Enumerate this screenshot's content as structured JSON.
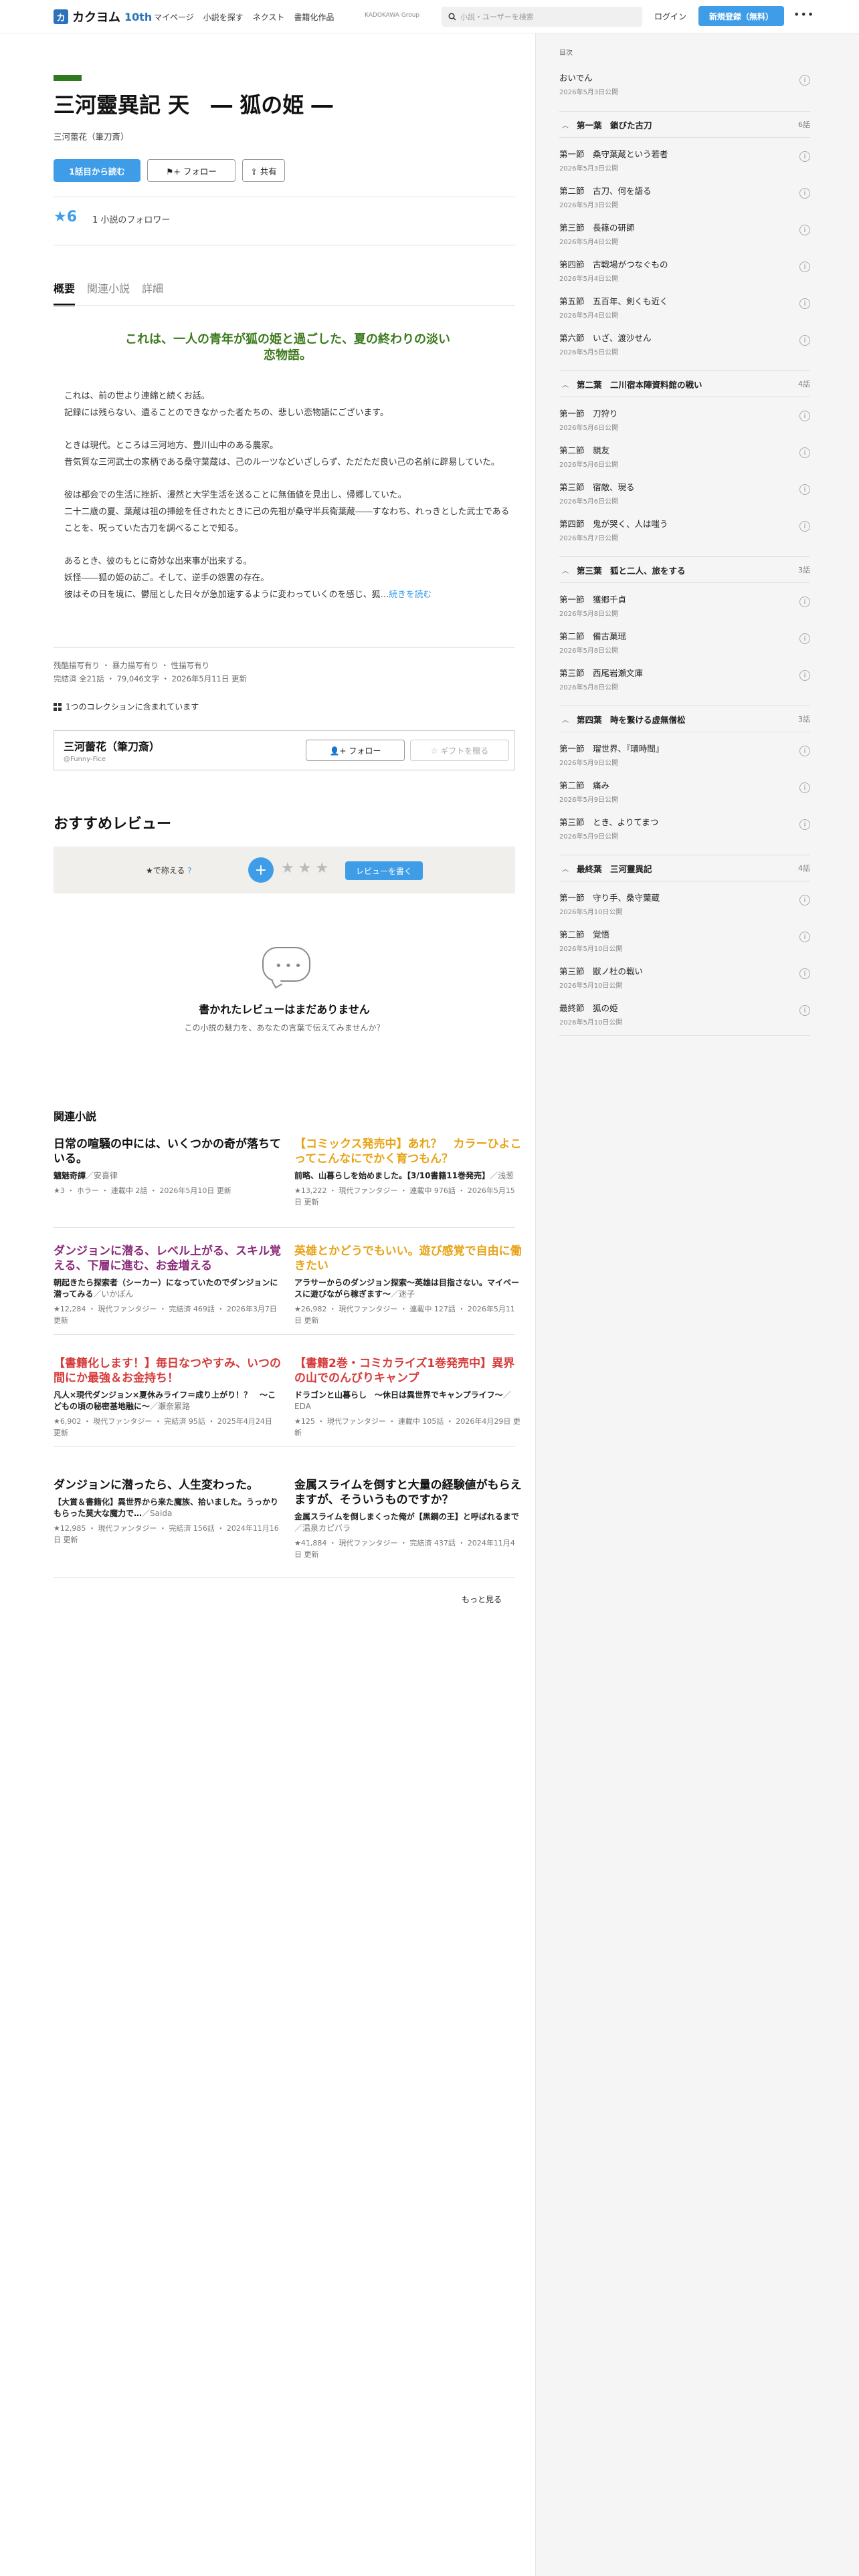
{
  "header": {
    "logo_mark": "カ",
    "logo_text": "カクヨム",
    "logo_10": "10th",
    "nav": [
      "マイページ",
      "小説を探す",
      "ネクスト",
      "書籍化作品"
    ],
    "group": "KADOKAWA Group",
    "search_placeholder": "小説・ユーザーを検索",
    "login": "ログイン",
    "signup": "新規登録（無料）",
    "more": "•••"
  },
  "work": {
    "title": "三河靈異記 天　― 狐の姫 ―",
    "author": "三河蕾花（筆刀斎）",
    "read_btn": "1話目から読む",
    "follow_btn": "フォロー",
    "share_btn": "共有",
    "stars": "★6",
    "followers": "1 小説のフォロワー",
    "tabs": [
      "概要",
      "関連小説",
      "詳細"
    ],
    "catchcopy": "これは、一人の青年が狐の姫と過ごした、夏の終わりの淡い恋物語。",
    "intro": [
      "これは、前の世より連綿と続くお話。\n記録には残らない、遺ることのできなかった者たちの、悲しい恋物語にございます。",
      "ときは現代。ところは三河地方、豊川山中のある農家。\n昔気質な三河武士の家柄である桑守葉蔵は、己のルーツなどいざしらず、ただただ良い己の名前に辟易していた。",
      "彼は都会での生活に挫折、漫然と大学生活を送ることに無価値を見出し、帰郷していた。\n二十二歳の夏、葉蔵は祖の挿絵を任されたときに己の先祖が桑守半兵衛葉蔵――すなわち、れっきとした武士であることを、呪っていた古刀を調べることで知る。",
      "あるとき、彼のもとに奇妙な出来事が出来する。\n妖怪――狐の姫の訪ご。そして、逆手の怨霊の存在。\n彼はその日を境に、鬱屈とした日々が急加速するように変わっていくのを感じ、狐…"
    ],
    "readmore": "続きを読む",
    "tags": "残酷描写有り ・ 暴力描写有り ・ 性描写有り",
    "status": "完結済 全21話 ・ 79,046文字 ・ 2026年5月11日 更新",
    "collection": "1つのコレクションに含まれています",
    "author_box": {
      "name": "三河蕾花（筆刀斎）",
      "id": "@Funny-Fice",
      "follow": "フォロー",
      "gift": "ギフトを贈る"
    }
  },
  "reviews": {
    "heading": "おすすめレビュー",
    "label": "★で称える",
    "help": "?",
    "plus": "+",
    "stars": "★★★",
    "write": "レビューを書く",
    "empty_title": "書かれたレビューはまだありません",
    "empty_sub": "この小説の魅力を、あなたの言葉で伝えてみませんか？",
    "bubble": "•••"
  },
  "related": {
    "heading": "関連小説",
    "more": "もっと見る",
    "items": [
      {
        "title": "日常の喧騒の中には、いくつかの奇が落ちている。",
        "color": "#111111",
        "sub": "魑魅奇譚",
        "sub_author": "／安喜律",
        "meta": "★3 ・ ホラー ・ 連載中 2話 ・ 2026年5月10日 更新"
      },
      {
        "title": "【コミックス発売中】あれ？　カラーひよこってこんなにでかく育つもん？",
        "color": "#e8a317",
        "sub": "前略、山暮らしを始めました。【3/10書籍11巻発売】",
        "sub_author": "／浅葱",
        "meta": "★13,222 ・ 現代ファンタジー ・ 連載中 976話 ・ 2026年5月15日 更新"
      },
      {
        "title": "ダンジョンに潜る、レベル上がる、スキル覚える、下層に進む、お金増える",
        "color": "#8a2a7a",
        "sub": "朝起きたら探索者（シーカー）になっていたのでダンジョンに潜ってみる",
        "sub_author": "／いかぽん",
        "meta": "★12,284 ・ 現代ファンタジー ・ 完結済 469話 ・ 2026年3月7日 更新"
      },
      {
        "title": "英雄とかどうでもいい。遊び感覚で自由に働きたい",
        "color": "#e8a317",
        "sub": "アラサーからのダンジョン探索〜英雄は目指さない。マイペースに遊びながら稼ぎます〜",
        "sub_author": "／迷子",
        "meta": "★26,982 ・ 現代ファンタジー ・ 連載中 127話 ・ 2026年5月11日 更新"
      },
      {
        "title": "【書籍化します！】毎日なつやすみ、いつの間にか最強＆お金持ち！",
        "color": "#d63a3a",
        "sub": "凡人×現代ダンジョン×夏休みライフ＝成り上がり！？　〜こどもの頃の秘密基地融に〜",
        "sub_author": "／瀬奈累路",
        "meta": "★6,902 ・ 現代ファンタジー ・ 完結済 95話 ・ 2025年4月24日 更新"
      },
      {
        "title": "【書籍2巻・コミカライズ1巻発売中】異界の山でのんびりキャンプ",
        "color": "#d63a3a",
        "sub": "ドラゴンと山暮らし　〜休日は異世界でキャンプライフ〜",
        "sub_author": "／EDA",
        "meta": "★125 ・ 現代ファンタジー ・ 連載中 105話 ・ 2026年4月29日 更新"
      },
      {
        "title": "ダンジョンに潜ったら、人生変わった。",
        "color": "#111111",
        "sub": "【大賞＆書籍化】異世界から来た魔族、拾いました。うっかりもらった莫大な魔力で…",
        "sub_author": "／Saida",
        "meta": "★12,985 ・ 現代ファンタジー ・ 完結済 156話 ・ 2024年11月16日 更新"
      },
      {
        "title": "金属スライムを倒すと大量の経験値がもらえますが、そういうものですか？",
        "color": "#111111",
        "sub": "金属スライムを倒しまくった俺が【黒鋼の王】と呼ばれるまで",
        "sub_author": "／温泉カピバラ",
        "meta": "★41,884 ・ 現代ファンタジー ・ 完結済 437話 ・ 2024年11月4日 更新"
      }
    ]
  },
  "toc": {
    "heading": "目次",
    "prologue": {
      "title": "おいでん",
      "date": "2026年5月3日公開"
    },
    "chapters": [
      {
        "title": "第一葉　鎖びた古刀",
        "count": "6話",
        "episodes": [
          {
            "title": "第一節　桑守葉蔵という若者",
            "date": "2026年5月3日公開"
          },
          {
            "title": "第二節　古刀、何を語る",
            "date": "2026年5月3日公開"
          },
          {
            "title": "第三節　長篠の研師",
            "date": "2026年5月4日公開"
          },
          {
            "title": "第四節　古戦場がつなぐもの",
            "date": "2026年5月4日公開"
          },
          {
            "title": "第五節　五百年、剣くも近く",
            "date": "2026年5月4日公開"
          },
          {
            "title": "第六節　いざ、渡沙せん",
            "date": "2026年5月5日公開"
          }
        ]
      },
      {
        "title": "第二葉　二川宿本陣資料館の戦い",
        "count": "4話",
        "episodes": [
          {
            "title": "第一節　刀狩り",
            "date": "2026年5月6日公開"
          },
          {
            "title": "第二節　親友",
            "date": "2026年5月6日公開"
          },
          {
            "title": "第三節　宿敵、現る",
            "date": "2026年5月6日公開"
          },
          {
            "title": "第四節　鬼が哭く、人は嗤う",
            "date": "2026年5月7日公開"
          }
        ]
      },
      {
        "title": "第三葉　狐と二人、旅をする",
        "count": "3話",
        "episodes": [
          {
            "title": "第一節　獲郷千貞",
            "date": "2026年5月8日公開"
          },
          {
            "title": "第二節　備古菓瑶",
            "date": "2026年5月8日公開"
          },
          {
            "title": "第三節　西尾岩瀬文庫",
            "date": "2026年5月8日公開"
          }
        ]
      },
      {
        "title": "第四葉　時を繋ける虚無僧松",
        "count": "3話",
        "episodes": [
          {
            "title": "第一節　瑠世界、『環時間』",
            "date": "2026年5月9日公開"
          },
          {
            "title": "第二節　痛み",
            "date": "2026年5月9日公開"
          },
          {
            "title": "第三節　とき、よりてまつ",
            "date": "2026年5月9日公開"
          }
        ]
      },
      {
        "title": "最終葉　三河靈異記",
        "count": "4話",
        "episodes": [
          {
            "title": "第一節　守り手、桑守葉蔵",
            "date": "2026年5月10日公開"
          },
          {
            "title": "第二節　覚悟",
            "date": "2026年5月10日公開"
          },
          {
            "title": "第三節　獣ノ杜の戦い",
            "date": "2026年5月10日公開"
          },
          {
            "title": "最終節　狐の姫",
            "date": "2026年5月10日公開"
          }
        ]
      }
    ]
  }
}
